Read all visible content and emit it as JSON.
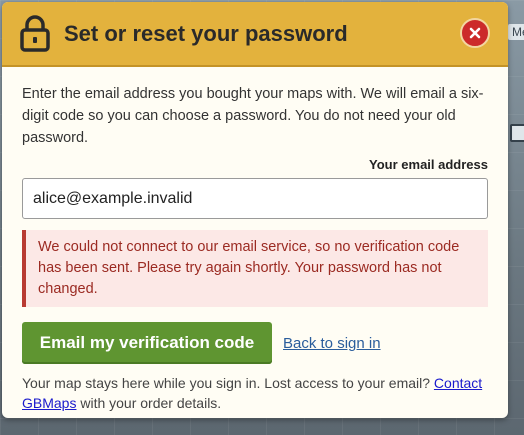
{
  "background": {
    "map_label": "Mes"
  },
  "dialog": {
    "title": "Set or reset your password",
    "intro": "Enter the email address you bought your maps with. We will email a six-digit code so you can choose a password. You do not need your old password.",
    "email_label": "Your email address",
    "email_value": "alice@example.invalid",
    "error_message": "We could not connect to our email service, so no verification code has been sent. Please try again shortly. Your password has not changed.",
    "submit_label": "Email my verification code",
    "back_label": "Back to sign in",
    "footer_prefix": "Your map stays here while you sign in. Lost access to your email?",
    "footer_link": "Contact GBMaps",
    "footer_suffix": "with your order details."
  },
  "colors": {
    "header": "#e3b23d",
    "close": "#cc2a2a",
    "primary": "#5f9531",
    "error_text": "#9b2a22",
    "error_bg": "#fce8e6",
    "link": "#2a5d9c"
  },
  "icons": {
    "header_icon": "lock-icon",
    "close_icon": "close-icon"
  }
}
